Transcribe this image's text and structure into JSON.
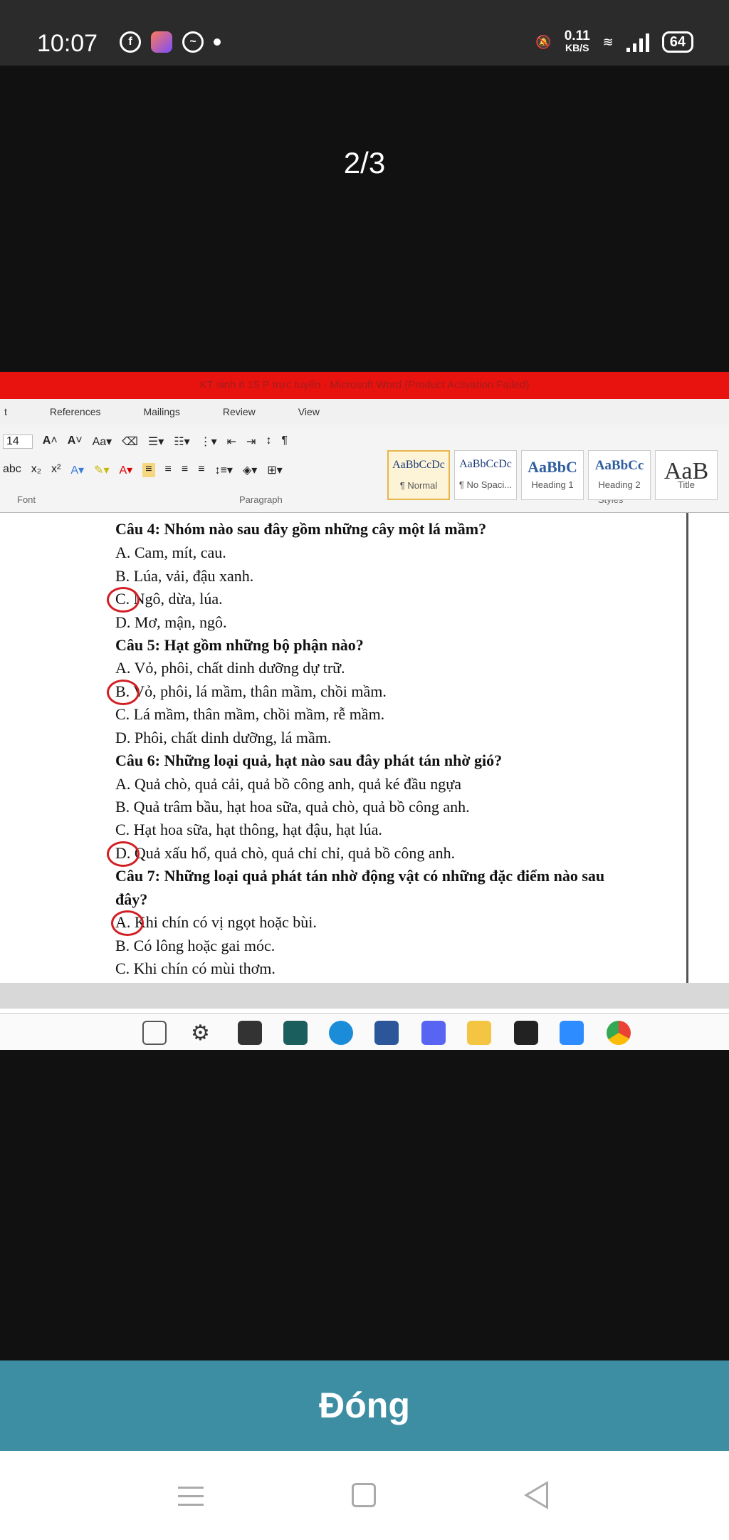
{
  "status_bar": {
    "time": "10:07",
    "net_speed_value": "0.11",
    "net_speed_unit": "KB/S",
    "battery": "64"
  },
  "viewer": {
    "counter": "2/3",
    "close_label": "Đóng"
  },
  "word": {
    "title": "KT sinh 6 15 P trực tuyến - Microsoft Word (Product Activation Failed)",
    "menu": [
      "t",
      "References",
      "Mailings",
      "Review",
      "View"
    ],
    "font_size": "14",
    "groups": {
      "font": "Font",
      "paragraph": "Paragraph",
      "styles": "Styles"
    },
    "styles": [
      {
        "sample": "AaBbCcDc",
        "name": "¶ Normal"
      },
      {
        "sample": "AaBbCcDc",
        "name": "¶ No Spaci..."
      },
      {
        "sample": "AaBbC",
        "name": "Heading 1"
      },
      {
        "sample": "AaBbCc",
        "name": "Heading 2"
      },
      {
        "sample": "AaB",
        "name": "Title"
      }
    ],
    "document_lines": [
      "Câu 4: Nhóm nào sau đây gồm những cây một lá mầm?",
      "A. Cam, mít, cau.",
      "B. Lúa, vải, đậu xanh.",
      "C. Ngô, dừa, lúa.",
      "D. Mơ, mận, ngô.",
      "Câu 5: Hạt gồm những bộ phận nào?",
      "A. Vỏ, phôi, chất dinh dưỡng dự trữ.",
      "B. Vỏ, phôi, lá mầm, thân mầm, chồi mầm.",
      "C. Lá mầm, thân mầm, chồi mầm, rễ mầm.",
      "D. Phôi, chất dinh dưỡng, lá mầm.",
      "Câu 6: Những loại quả, hạt nào sau đây phát tán nhờ gió?",
      "A. Quả chò, quả cải, quả bồ công anh, quả ké đầu ngựa",
      "B.  Quả trâm bầu, hạt hoa sữa, quả chò, quả bồ công anh.",
      "C.  Hạt hoa sữa, hạt thông, hạt đậu, hạt lúa.",
      "D. Quả xấu hổ, quả chò, quả chỉ chỉ, quả bồ công anh.",
      "Câu 7: Những loại quả phát tán nhờ động vật có những đặc điểm nào sau",
      "đây?",
      "A. Khi chín có vị ngọt hoặc bùi.",
      "B. Có lông hoặc gai móc.",
      "C. Khi chín có mùi thơm."
    ]
  }
}
